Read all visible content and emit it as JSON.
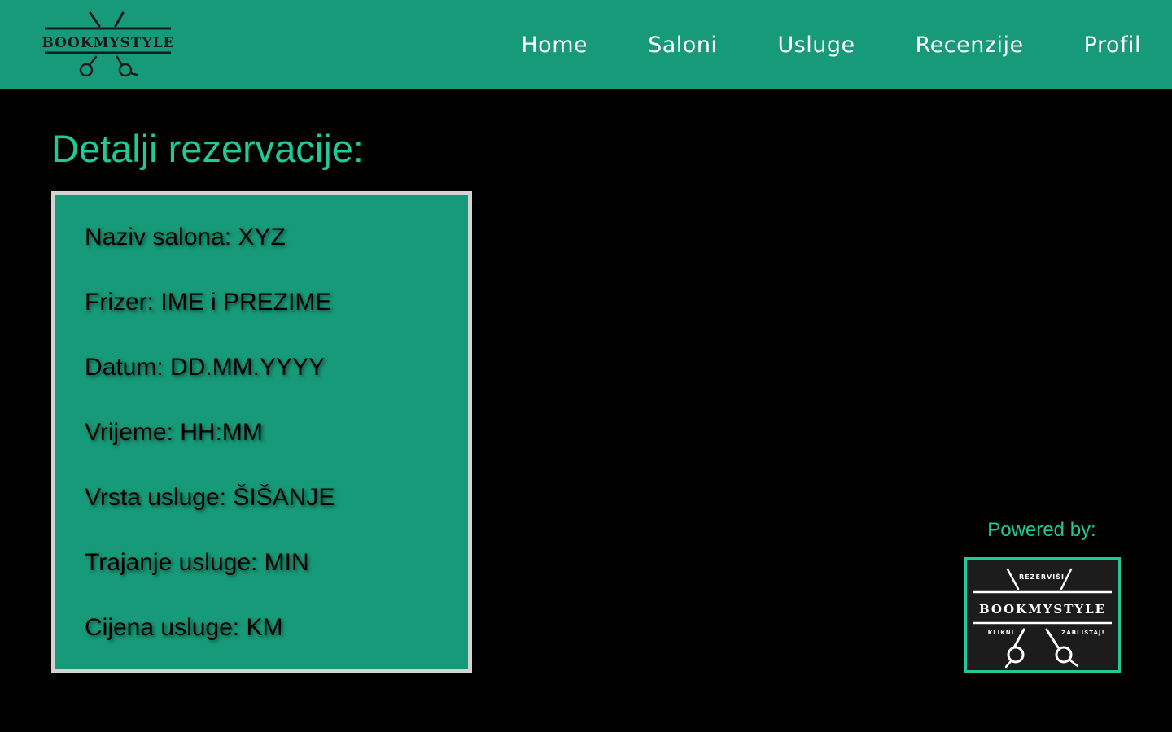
{
  "header": {
    "logo_text": "BOOKMYSTYLE",
    "nav": [
      "Home",
      "Saloni",
      "Usluge",
      "Recenzije",
      "Profil"
    ]
  },
  "main": {
    "title": "Detalji rezervacije:",
    "details": [
      "Naziv salona: XYZ",
      "Frizer: IME i PREZIME",
      "Datum: DD.MM.YYYY",
      "Vrijeme: HH:MM",
      "Vrsta usluge: ŠIŠANJE",
      "Trajanje usluge: MIN",
      "Cijena usluge: KM"
    ]
  },
  "footer": {
    "powered_by": "Powered by:",
    "badge": {
      "top": "REZERVIŠI",
      "name": "BOOKMYSTYLE",
      "left": "KLIKNI",
      "right": "ZABLISTAJ!"
    }
  },
  "colors": {
    "brand": "#179a79",
    "accent": "#22c896",
    "background": "#000000",
    "card_border": "#d3d3d3"
  }
}
